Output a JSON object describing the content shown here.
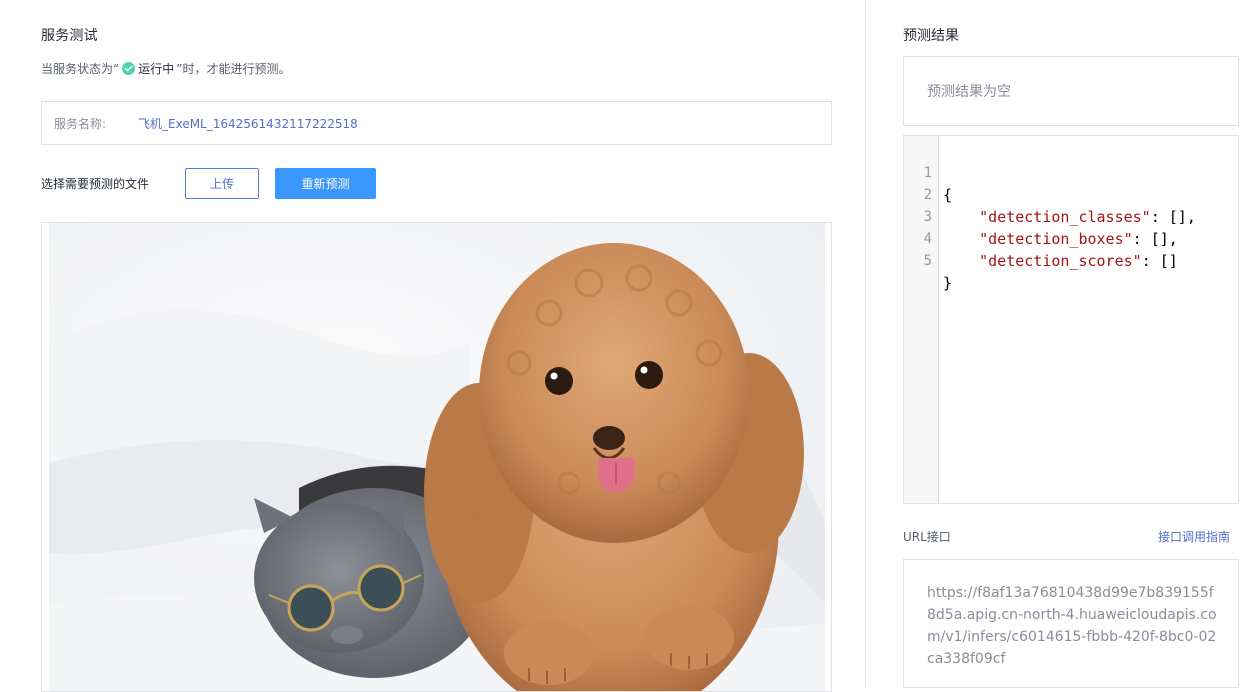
{
  "service_test": {
    "title": "服务测试",
    "status_prefix": "当服务状态为“",
    "status_running": "运行中",
    "status_suffix": "”时，才能进行预测。",
    "service_name_label": "服务名称:",
    "service_name_value": "飞机_ExeML_1642561432117222518",
    "select_file_label": "选择需要预测的文件",
    "upload_button": "上传",
    "repredict_button": "重新预测"
  },
  "prediction": {
    "title": "预测结果",
    "empty_text": "预测结果为空",
    "json_lines": [
      {
        "num": "1",
        "text": "{"
      },
      {
        "num": "2",
        "key": "\"detection_classes\"",
        "rest": ": [],"
      },
      {
        "num": "3",
        "key": "\"detection_boxes\"",
        "rest": ": [],"
      },
      {
        "num": "4",
        "key": "\"detection_scores\"",
        "rest": ": []"
      },
      {
        "num": "5",
        "text": "}"
      }
    ]
  },
  "url_interface": {
    "label": "URL接口",
    "guide_link": "接口调用指南",
    "url": "https://f8af13a76810438d99e7b839155f8d5a.apig.cn-north-4.huaweicloudapis.com/v1/infers/c6014615-fbbb-420f-8bc0-02ca338f09cf"
  },
  "colors": {
    "primary_button": "#3b97fb",
    "link": "#526ecc",
    "success": "#50d4ab",
    "json_key": "#a31515",
    "json_brace": "#00a000"
  },
  "icons": {
    "status": "check-circle-icon"
  }
}
